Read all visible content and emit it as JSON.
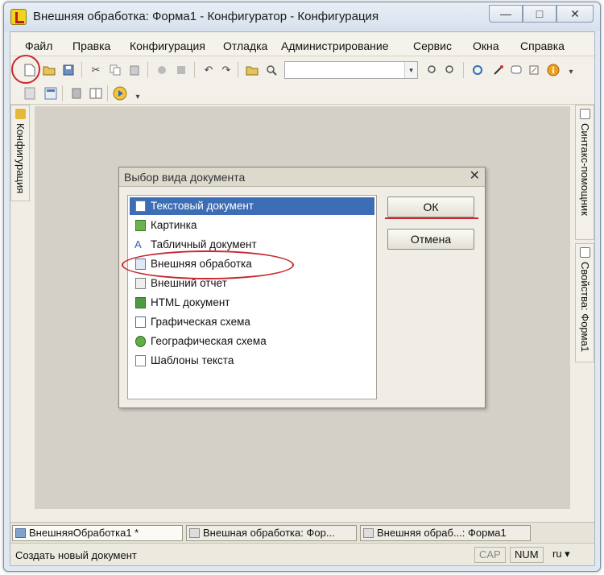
{
  "window": {
    "title": "Внешняя обработка: Форма1 - Конфигуратор - Конфигурация",
    "minimize_glyph": "—",
    "maximize_glyph": "□",
    "close_glyph": "✕"
  },
  "menu": [
    "Файл",
    "Правка",
    "Конфигурация",
    "Отладка",
    "Администрирование",
    "Сервис",
    "Окна",
    "Справка"
  ],
  "toolbar": {
    "search_value": "",
    "combo_arrow": "▾"
  },
  "side_panels": {
    "left": "Конфигурация",
    "right_top": "Синтакс-помощник",
    "right_bottom": "Свойства: Форма1"
  },
  "dialog": {
    "title": "Выбор вида документа",
    "close_glyph": "✕",
    "items": [
      {
        "label": "Текстовый документ",
        "icon": "text-document-icon"
      },
      {
        "label": "Картинка",
        "icon": "picture-icon"
      },
      {
        "label": "Табличный документ",
        "icon": "spreadsheet-icon"
      },
      {
        "label": "Внешняя обработка",
        "icon": "external-processing-icon"
      },
      {
        "label": "Внешний отчет",
        "icon": "external-report-icon"
      },
      {
        "label": "HTML документ",
        "icon": "html-document-icon"
      },
      {
        "label": "Графическая схема",
        "icon": "graphic-scheme-icon"
      },
      {
        "label": "Географическая схема",
        "icon": "geo-scheme-icon"
      },
      {
        "label": "Шаблоны текста",
        "icon": "text-templates-icon"
      }
    ],
    "selected_index": 0,
    "ok_label": "ОК",
    "cancel_label": "Отмена"
  },
  "taskbar": [
    {
      "label": "ВнешняяОбработка1 *",
      "active": true
    },
    {
      "label": "Внешная обработка: Фор...",
      "active": false
    },
    {
      "label": "Внешняя обраб...: Форма1",
      "active": false
    }
  ],
  "status": {
    "text": "Создать новый документ",
    "cap": "CAP",
    "num": "NUM",
    "lang": "ru ▾"
  },
  "colors": {
    "selection": "#3d6eb5",
    "annotation": "#c8282e"
  }
}
